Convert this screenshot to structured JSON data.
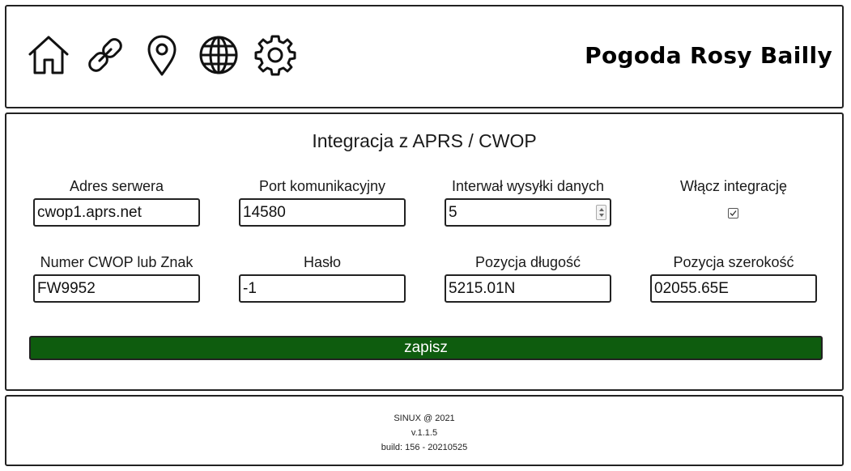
{
  "header": {
    "nav_icons": [
      "home-icon",
      "link-icon",
      "location-pin-icon",
      "globe-icon",
      "gear-icon"
    ],
    "title": "Pogoda Rosy Bailly"
  },
  "main": {
    "title": "Integracja z APRS / CWOP",
    "fields": {
      "server": {
        "label": "Adres serwera",
        "value": "cwop1.aprs.net"
      },
      "port": {
        "label": "Port komunikacyjny",
        "value": "14580"
      },
      "interval": {
        "label": "Interwał wysyłki danych",
        "value": "5"
      },
      "enable": {
        "label": "Włącz integrację",
        "checked": true
      },
      "callsign": {
        "label": "Numer CWOP lub Znak",
        "value": "FW9952"
      },
      "password": {
        "label": "Hasło",
        "value": "-1"
      },
      "longitude": {
        "label": "Pozycja długość",
        "value": "5215.01N"
      },
      "latitude": {
        "label": "Pozycja szerokość",
        "value": "02055.65E"
      }
    },
    "save_label": "zapisz",
    "colors": {
      "save_button": "#0e5c0e"
    }
  },
  "footer": {
    "copyright": "SINUX @ 2021",
    "version": "v.1.1.5",
    "build": "build: 156 - 20210525"
  }
}
